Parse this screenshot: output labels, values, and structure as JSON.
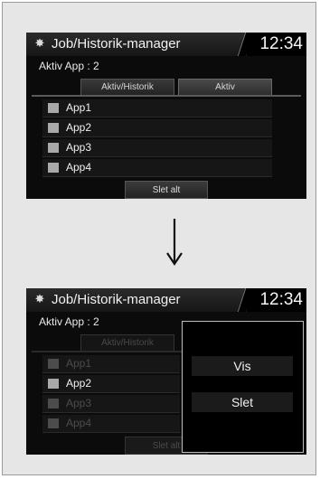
{
  "screen_before": {
    "title": "Job/Historik-manager",
    "clock": "12:34",
    "subtitle": "Aktiv App : 2",
    "tabs": [
      "Aktiv/Historik",
      "Aktiv"
    ],
    "apps": [
      "App1",
      "App2",
      "App3",
      "App4"
    ],
    "delete_all": "Slet alt"
  },
  "screen_after": {
    "title": "Job/Historik-manager",
    "clock": "12:34",
    "subtitle": "Aktiv App : 2",
    "tabs": [
      "Aktiv/Historik"
    ],
    "apps": [
      "App1",
      "App2",
      "App3",
      "App4"
    ],
    "delete_all": "Slet alt",
    "popup": {
      "view": "Vis",
      "delete": "Slet"
    }
  },
  "icons": {
    "settings": "gear-icon",
    "transition": "arrow-down-icon"
  }
}
